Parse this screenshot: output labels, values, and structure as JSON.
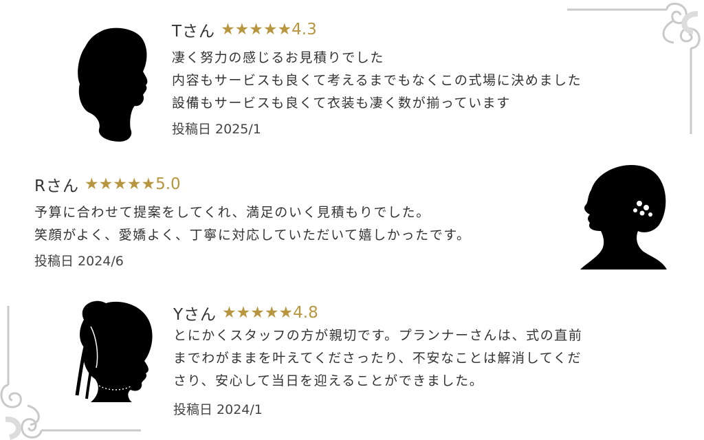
{
  "reviews": [
    {
      "name": "Tさん",
      "stars": "★★★★★",
      "rating": "4.3",
      "lines": [
        "凄く努力の感じるお見積りでした",
        "内容もサービスも良くて考えるまでもなくこの式場に決めました",
        "設備もサービスも良くて衣装も凄く数が揃っています"
      ],
      "posted": "投稿日 2025/1",
      "avatar_icon": "man-silhouette-icon"
    },
    {
      "name": "Rさん",
      "stars": "★★★★★",
      "rating": "5.0",
      "lines": [
        "予算に合わせて提案をしてくれ、満足のいく見積もりでした。",
        "笑顔がよく、愛嬌よく、丁寧に対応していただいて嬉しかったです。"
      ],
      "posted": "投稿日 2024/6",
      "avatar_icon": "woman-updo-silhouette-icon"
    },
    {
      "name": "Yさん",
      "stars": "★★★★★",
      "rating": "4.8",
      "lines": [
        "とにかくスタッフの方が親切です。プランナーさんは、式の直前",
        "までわがままを叶えてくださったり、不安なことは解消してくだ",
        "さり、安心して当日を迎えることができました。"
      ],
      "posted": "投稿日 2024/1",
      "avatar_icon": "woman-ribbon-silhouette-icon"
    }
  ],
  "colors": {
    "star": "#b8963f",
    "ornament": "#c8c8c8",
    "text": "#333333"
  }
}
